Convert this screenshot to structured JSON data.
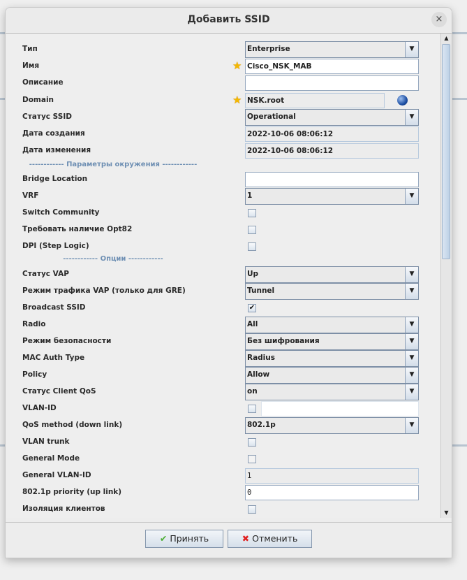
{
  "dialog": {
    "title": "Добавить SSID",
    "close_label": "×"
  },
  "form": [
    {
      "label": "Тип",
      "kind": "combo",
      "value": "Enterprise"
    },
    {
      "label": "Имя",
      "kind": "text",
      "value": "Cisco_NSK_MAB",
      "required": true
    },
    {
      "label": "Описание",
      "kind": "text",
      "value": ""
    },
    {
      "label": "Domain",
      "kind": "domain",
      "value": "NSK.root",
      "required": true
    },
    {
      "label": "Статус SSID",
      "kind": "combo",
      "value": "Operational"
    },
    {
      "label": "Дата создания",
      "kind": "ro",
      "value": "2022-10-06 08:06:12"
    },
    {
      "label": "Дата изменения",
      "kind": "ro",
      "value": "2022-10-06 08:06:12"
    },
    {
      "kind": "section",
      "label": "------------ Параметры окружения ------------"
    },
    {
      "label": "Bridge Location",
      "kind": "text",
      "value": ""
    },
    {
      "label": "VRF",
      "kind": "combo",
      "value": "1"
    },
    {
      "label": "Switch Community",
      "kind": "check",
      "checked": false
    },
    {
      "label": "Требовать наличие Opt82",
      "kind": "check",
      "checked": false
    },
    {
      "label": "DPI (Step Logic)",
      "kind": "check",
      "checked": false
    },
    {
      "kind": "section",
      "label": "------------ Опции ------------"
    },
    {
      "label": "Статус VAP",
      "kind": "combo",
      "value": "Up"
    },
    {
      "label": "Режим трафика VAP (только для GRE)",
      "kind": "combo",
      "value": "Tunnel"
    },
    {
      "label": "Broadcast SSID",
      "kind": "check",
      "checked": true
    },
    {
      "label": "Radio",
      "kind": "combo",
      "value": "All"
    },
    {
      "label": "Режим безопасности",
      "kind": "combo",
      "value": "Без шифрования"
    },
    {
      "label": "MAC Auth Type",
      "kind": "combo",
      "value": "Radius"
    },
    {
      "label": "Policy",
      "kind": "combo",
      "value": "Allow"
    },
    {
      "label": "Статус Client QoS",
      "kind": "combo",
      "value": "on"
    },
    {
      "label": "VLAN-ID",
      "kind": "checktext",
      "checked": false,
      "value": ""
    },
    {
      "label": "QoS method (down link)",
      "kind": "combo",
      "value": "802.1p"
    },
    {
      "label": "VLAN trunk",
      "kind": "check",
      "checked": false
    },
    {
      "label": "General Mode",
      "kind": "check",
      "checked": false,
      "flat": true
    },
    {
      "label": "General VLAN-ID",
      "kind": "roplain",
      "value": "1"
    },
    {
      "label": "802.1p priority (up link)",
      "kind": "textplain",
      "value": "0"
    },
    {
      "label": "Изоляция клиентов",
      "kind": "check",
      "checked": false
    }
  ],
  "buttons": {
    "ok": "Принять",
    "cancel": "Отменить"
  },
  "icons": {
    "ok": "✔",
    "cancel": "✖",
    "required": "★",
    "dropdown": "▼"
  }
}
